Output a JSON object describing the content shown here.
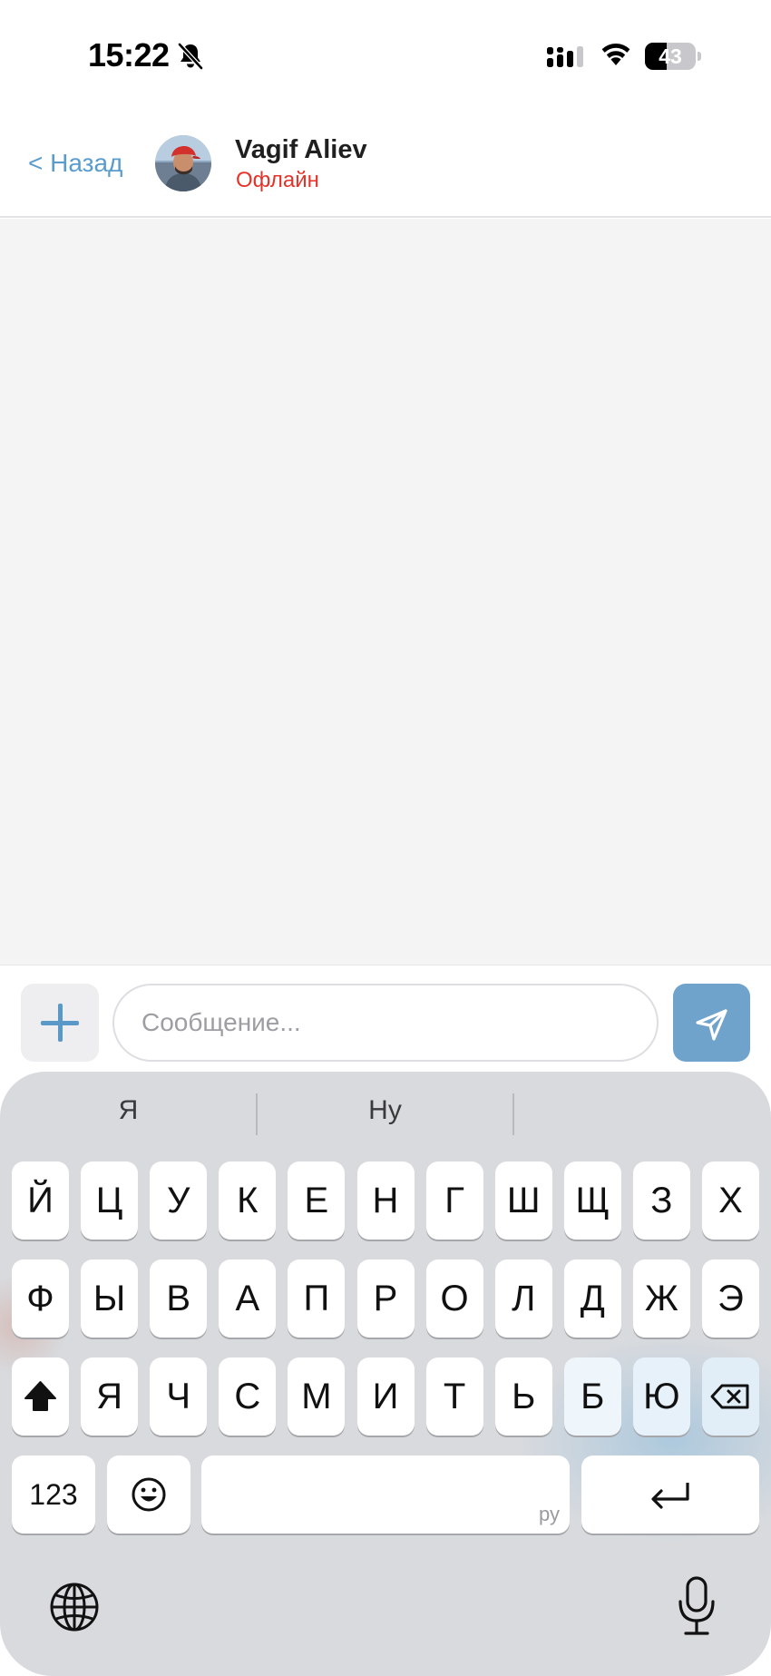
{
  "status_bar": {
    "time": "15:22",
    "battery_level": "43",
    "icons": [
      "bell-slash-icon",
      "signal-icon",
      "wifi-icon",
      "battery-icon"
    ]
  },
  "header": {
    "back_label": "< Назад",
    "contact_name": "Vagif Aliev",
    "contact_status": "Офлайн",
    "status_color": "#e5332a",
    "accent_color": "#5a9ccd"
  },
  "composer": {
    "placeholder": "Сообщение...",
    "value": "",
    "attach_icon": "plus-icon",
    "send_icon": "send-icon",
    "send_color": "#6fa3cc"
  },
  "keyboard": {
    "suggestions": [
      "Я",
      "Ну",
      ""
    ],
    "row1": [
      "Й",
      "Ц",
      "У",
      "К",
      "Е",
      "Н",
      "Г",
      "Ш",
      "Щ",
      "З",
      "Х"
    ],
    "row2": [
      "Ф",
      "Ы",
      "В",
      "А",
      "П",
      "Р",
      "О",
      "Л",
      "Д",
      "Ж",
      "Э"
    ],
    "row3": [
      "Я",
      "Ч",
      "С",
      "М",
      "И",
      "Т",
      "Ь",
      "Б",
      "Ю"
    ],
    "numbers_label": "123",
    "space_language": "ру",
    "icons": [
      "shift-icon",
      "backspace-icon",
      "emoji-icon",
      "return-icon",
      "globe-icon",
      "microphone-icon"
    ]
  }
}
